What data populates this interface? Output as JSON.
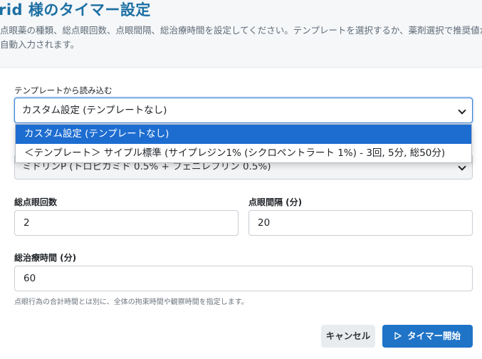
{
  "header": {
    "title": "rid 様のタイマー設定",
    "description": "点眼薬の種類、総点眼回数、点眼間隔、総治療時間を設定してください。テンプレートを選択するか、薬剤選択で推奨値が自動入力されます。"
  },
  "template": {
    "label": "テンプレートから読み込む",
    "selected": "カスタム設定 (テンプレートなし)",
    "options": [
      "カスタム設定 (テンプレートなし)",
      "＜テンプレート＞ サイプル標準 (サイプレジン1% (シクロペントラート 1%) - 3回, 5分, 総50分)"
    ]
  },
  "medication": {
    "selected": "ミドリンP (トロピカミド 0.5% + フェニレフリン 0.5%)"
  },
  "fields": {
    "total_count_label": "総点眼回数",
    "total_count_value": "2",
    "interval_label": "点眼間隔 (分)",
    "interval_value": "20",
    "total_time_label": "総治療時間 (分)",
    "total_time_value": "60",
    "help_text": "点眼行為の合計時間とは別に、全体の拘束時間や観察時間を指定します。"
  },
  "actions": {
    "cancel_label": "キャンセル",
    "start_label": "タイマー開始"
  },
  "colors": {
    "accent": "#1f74c8",
    "title": "#1c6fa3",
    "selected_option": "#1d6dd1"
  }
}
